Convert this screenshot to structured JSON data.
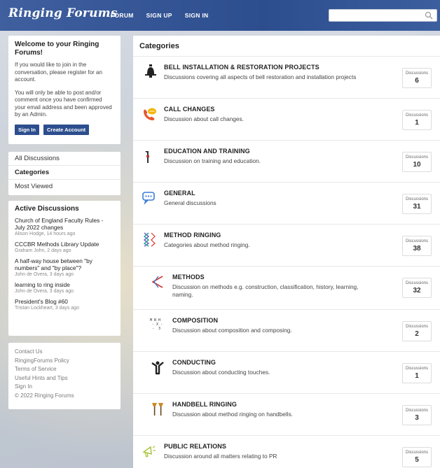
{
  "header": {
    "logo": "Ringing Forums",
    "nav": [
      "FORUM",
      "SIGN UP",
      "SIGN IN"
    ],
    "search_placeholder": ""
  },
  "welcome": {
    "title": "Welcome to your Ringing Forums!",
    "para1": "If you would like to join in the conversation, please register for an account.",
    "para2": "You will only be able to post and/or comment once you have confirmed your email address and been approved by an Admin.",
    "sign_in": "Sign In",
    "create_account": "Create Account"
  },
  "sidebar_nav": [
    "All Discussions",
    "Categories",
    "Most Viewed"
  ],
  "active_discussions": {
    "title": "Active Discussions",
    "items": [
      {
        "title": "Church of England Faculty Rules - July 2022 changes",
        "meta": "Alison Hodge, 14 hours ago"
      },
      {
        "title": "CCCBR Methods Library Update",
        "meta": "Graham John, 2 days ago"
      },
      {
        "title": "A half-way house between \"by numbers\" and \"by place\"?",
        "meta": "John de Overa, 3 days ago"
      },
      {
        "title": "learning to ring inside",
        "meta": "John de Overa, 3 days ago"
      },
      {
        "title": "President's Blog #60",
        "meta": "Tristan Lockheart, 3 days ago"
      }
    ]
  },
  "footer_links": [
    "Contact Us",
    "RingingForums Policy",
    "Terms of Service",
    "Useful Hints and Tips",
    "Sign In",
    "© 2022 Ringing Forums"
  ],
  "main": {
    "title": "Categories",
    "count_label": "Discussions",
    "categories": [
      {
        "title": "BELL INSTALLATION & RESTORATION PROJECTS",
        "desc": "Discussions covering all aspects of bell restoration and installation projects",
        "count": "6",
        "icon": "bell-icon",
        "color": "#222222"
      },
      {
        "title": "CALL CHANGES",
        "desc": "Discussion about call changes.",
        "count": "1",
        "icon": "phone-icon",
        "color": "#e8572a"
      },
      {
        "title": "EDUCATION AND TRAINING",
        "desc": "Discussion on training and education.",
        "count": "10",
        "icon": "rope-icon",
        "color": "#333333"
      },
      {
        "title": "GENERAL",
        "desc": "General discussions",
        "count": "31",
        "icon": "chat-icon",
        "color": "#3a7bd5"
      },
      {
        "title": "METHOD RINGING",
        "desc": "Categories about method ringing.",
        "count": "38",
        "icon": "method-lines-icon",
        "color": "#7b5cc4"
      },
      {
        "title": "METHODS",
        "desc": "Discussion on methods e.g. construction, classification, history, learning, naming.",
        "count": "32",
        "icon": "methods-icon",
        "color": "#d9342b"
      },
      {
        "title": "COMPOSITION",
        "desc": "Discussion about composition and composing.",
        "count": "2",
        "icon": "composition-icon",
        "color": "#333333"
      },
      {
        "title": "CONDUCTING",
        "desc": "Discussion about conducting touches.",
        "count": "1",
        "icon": "conductor-icon",
        "color": "#222222"
      },
      {
        "title": "HANDBELL RINGING",
        "desc": "Discussion about method ringing on handbells.",
        "count": "3",
        "icon": "handbell-icon",
        "color": "#8b5a1e"
      },
      {
        "title": "PUBLIC RELATIONS",
        "desc": "Discussion around all matters relating to PR",
        "count": "5",
        "icon": "megaphone-icon",
        "color": "#a8c43a"
      }
    ]
  },
  "composition_icon_text": "M B H\n - X -\n -  3"
}
